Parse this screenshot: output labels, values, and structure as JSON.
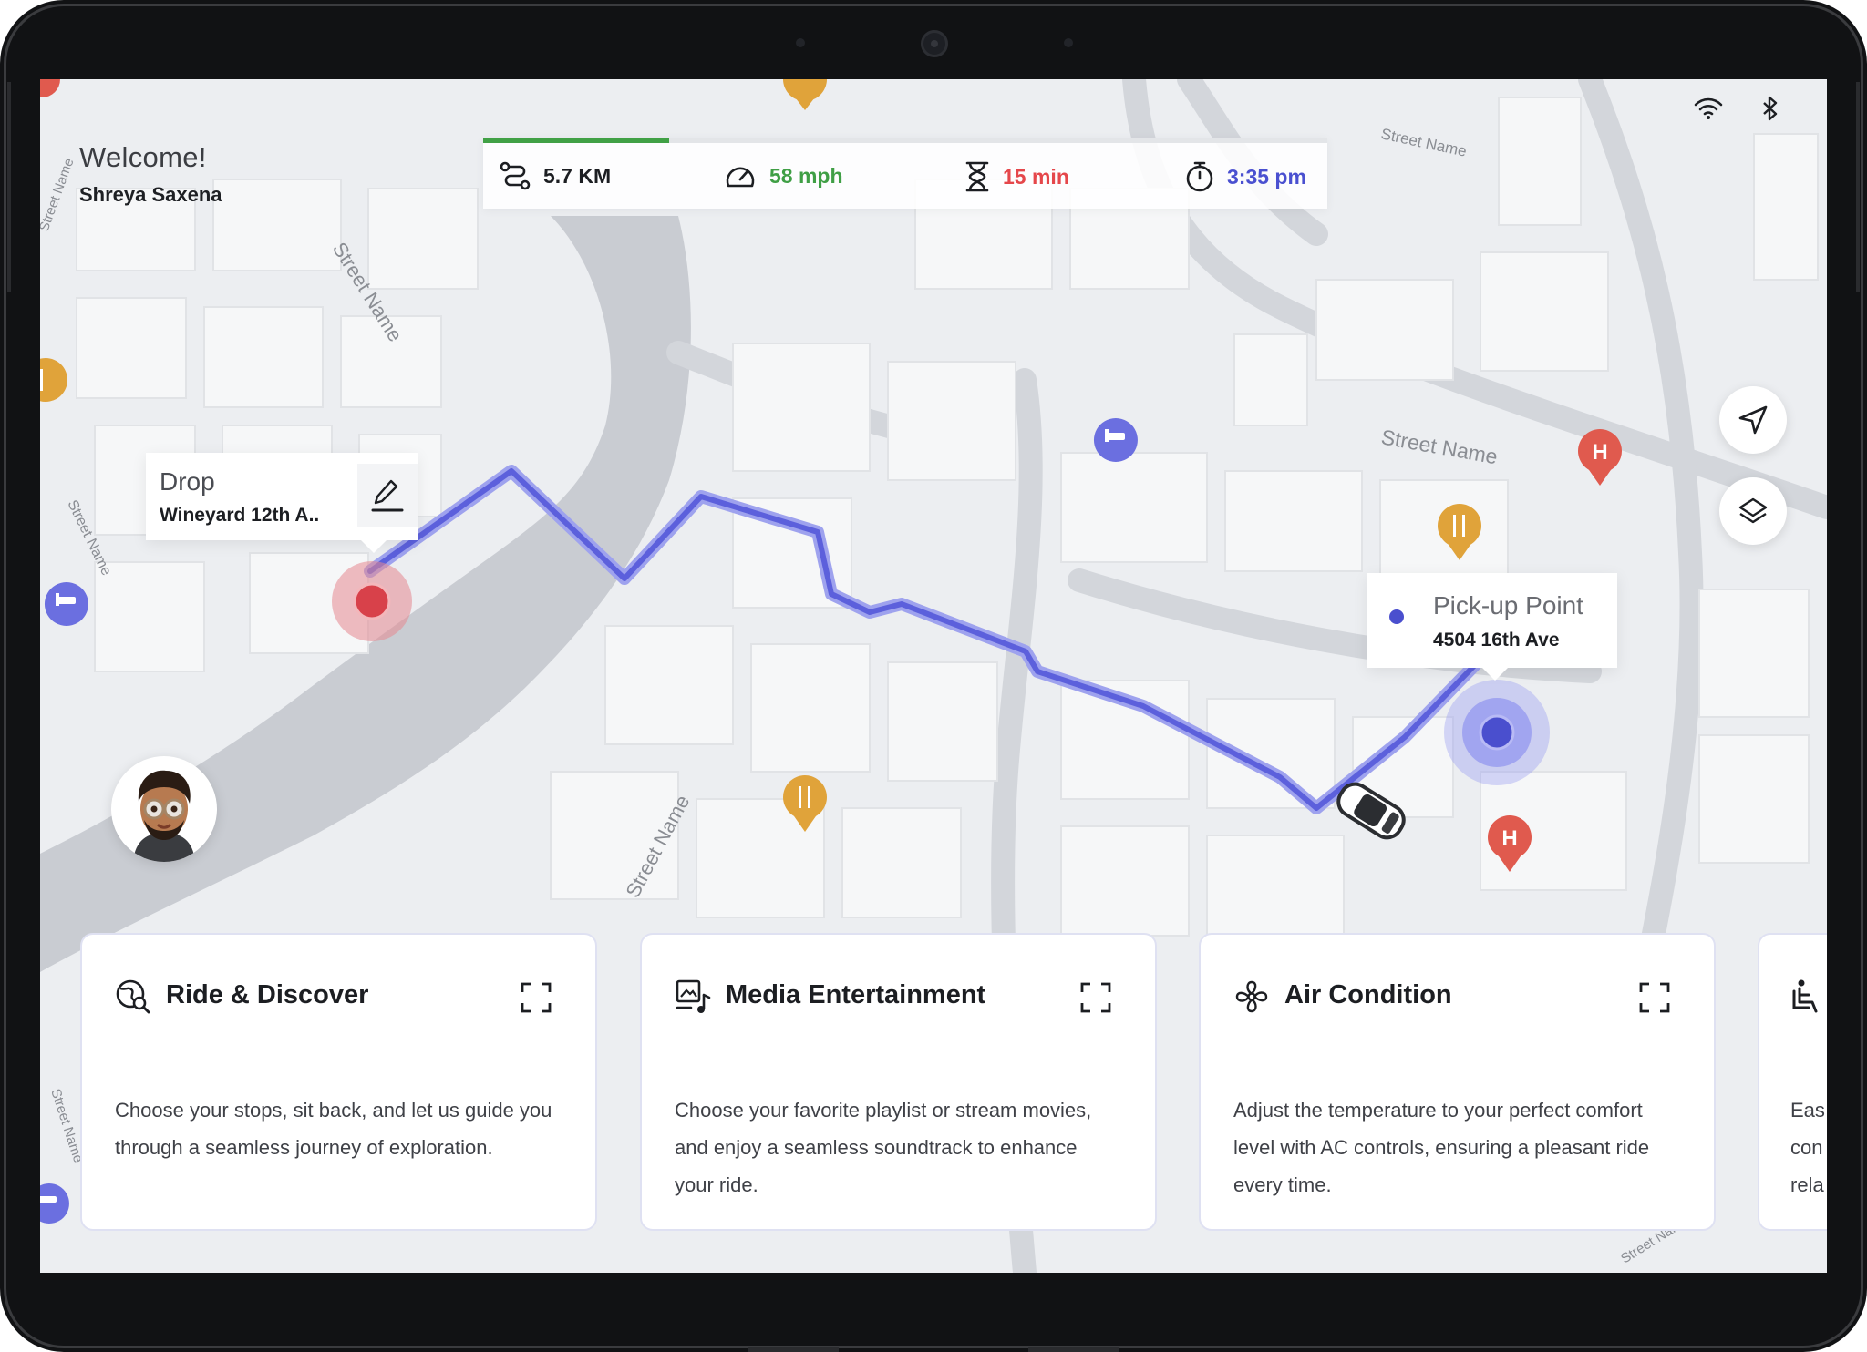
{
  "welcome": {
    "greeting": "Welcome!",
    "user_name": "Shreya Saxena"
  },
  "trip": {
    "progress": 0.22,
    "distance": "5.7 KM",
    "speed": "58 mph",
    "duration": "15 min",
    "arrival": "3:35 pm"
  },
  "colors": {
    "distance": "#1c1e22",
    "speed": "#3f9f45",
    "duration": "#e5474b",
    "arrival": "#4a50d0",
    "route": "#5c60dc",
    "drop": "#d8414a",
    "pickup": "#4a4fce"
  },
  "map": {
    "street_label": "Street Name"
  },
  "drop": {
    "label": "Drop",
    "address": "Wineyard 12th A.."
  },
  "pickup": {
    "label": "Pick-up Point",
    "address": "4504 16th Ave"
  },
  "pins": {
    "hospital_letter": "H"
  },
  "cards": [
    {
      "title": "Ride & Discover",
      "icon": "globe-search-icon",
      "description": "Choose your stops, sit back, and let us guide you through a seamless journey of exploration."
    },
    {
      "title": "Media Entertainment",
      "icon": "media-music-icon",
      "description": "Choose your favorite playlist or stream movies, and enjoy a seamless soundtrack to enhance your ride."
    },
    {
      "title": "Air Condition",
      "icon": "fan-icon",
      "description": "Adjust the temperature to your perfect comfort level with AC controls, ensuring a pleasant ride every time."
    },
    {
      "icon": "seat-icon",
      "description_lines": [
        "Eas",
        "con",
        "rela"
      ]
    }
  ]
}
